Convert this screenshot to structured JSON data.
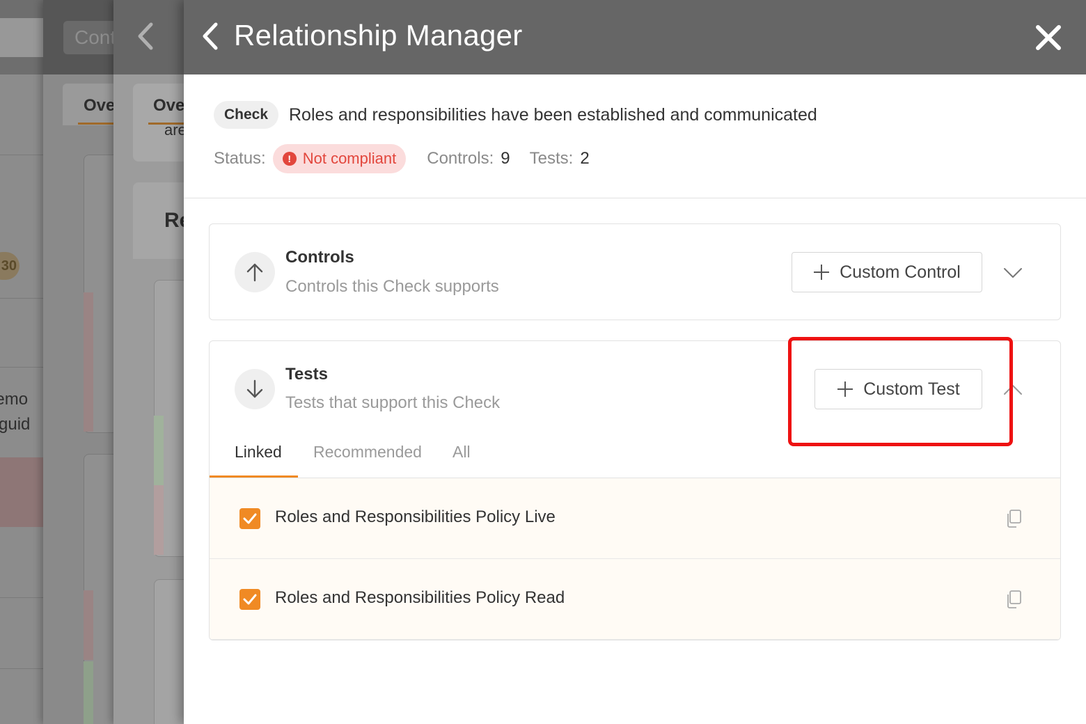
{
  "background": {
    "layer1_header_pill": "Cont",
    "layer1_tab": "Ove",
    "layer2_tab": "Ove",
    "layer2_tab_sub": "are",
    "layer2_card_heading": "Re",
    "layer0_badge": "30",
    "layer0_text_1": "n demo",
    "layer0_text_2": "or guid"
  },
  "panel": {
    "title": "Relationship Manager"
  },
  "summary": {
    "chip": "Check",
    "title": "Roles and responsibilities have been established and communicated",
    "status_label": "Status:",
    "status_value": "Not compliant",
    "status_icon": "!",
    "controls_label": "Controls:",
    "controls_value": "9",
    "tests_label": "Tests:",
    "tests_value": "2"
  },
  "controls": {
    "title": "Controls",
    "subtitle": "Controls this Check supports",
    "add_label": "Custom Control"
  },
  "tests": {
    "title": "Tests",
    "subtitle": "Tests that support this Check",
    "add_label": "Custom Test",
    "tabs": [
      {
        "label": "Linked"
      },
      {
        "label": "Recommended"
      },
      {
        "label": "All"
      }
    ],
    "items": [
      {
        "label": "Roles and Responsibilities Policy Live"
      },
      {
        "label": "Roles and Responsibilities Policy Read"
      }
    ]
  },
  "colors": {
    "accent": "#f08a24",
    "status_red": "#e2463c",
    "highlight": "#ee1111",
    "header": "#666666"
  }
}
